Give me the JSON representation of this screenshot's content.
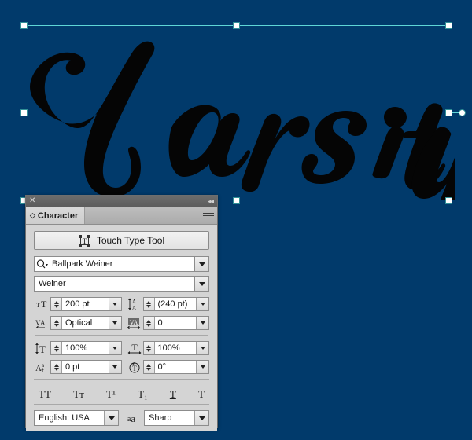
{
  "canvas": {
    "background_color": "#013a6b",
    "artwork_text": "Varsity",
    "artwork_color": "#050505",
    "selection": {
      "guide_color": "#5fd6d6",
      "handle_fill": "#ffffff",
      "handle_count": 8,
      "rotation_handle": "rotation-handle"
    }
  },
  "panel": {
    "titlebar": {
      "close_icon": "close-icon",
      "collapse_icon": "collapse-double-chevron-icon"
    },
    "tab": {
      "label": "Character",
      "caret_icon": "tab-caret-icon",
      "menu_icon": "panel-menu-icon"
    },
    "touch_type_tool": {
      "label": "Touch Type Tool",
      "icon": "touch-type-tool-icon"
    },
    "font_family": {
      "value": "Ballpark Weiner",
      "search_icon": "font-search-icon",
      "dropdown_icon": "chevron-down-icon"
    },
    "font_style": {
      "value": "Weiner",
      "dropdown_icon": "chevron-down-icon"
    },
    "fields": [
      {
        "name": "font-size",
        "icon": "font-size-icon",
        "value": "200 pt"
      },
      {
        "name": "leading",
        "icon": "leading-icon",
        "value": "(240 pt)"
      },
      {
        "name": "kerning",
        "icon": "kerning-icon",
        "value": "Optical"
      },
      {
        "name": "tracking",
        "icon": "tracking-icon",
        "value": "0"
      },
      {
        "name": "vertical-scale",
        "icon": "vertical-scale-icon",
        "value": "100%"
      },
      {
        "name": "horizontal-scale",
        "icon": "horizontal-scale-icon",
        "value": "100%"
      },
      {
        "name": "baseline-shift",
        "icon": "baseline-shift-icon",
        "value": "0 pt"
      },
      {
        "name": "character-rotation",
        "icon": "character-rotation-icon",
        "value": "0°"
      }
    ],
    "style_buttons": [
      {
        "name": "all-caps",
        "label": "TT"
      },
      {
        "name": "small-caps",
        "label": "Tᴛ"
      },
      {
        "name": "superscript",
        "label": "T¹"
      },
      {
        "name": "subscript",
        "label": "T₁"
      },
      {
        "name": "underline",
        "label": "T"
      },
      {
        "name": "strikethrough",
        "label": "T"
      }
    ],
    "language": {
      "value": "English: USA",
      "dropdown_icon": "chevron-down-icon"
    },
    "anti_aliasing": {
      "icon": "anti-aliasing-icon",
      "value": "Sharp",
      "dropdown_icon": "chevron-down-icon"
    }
  }
}
